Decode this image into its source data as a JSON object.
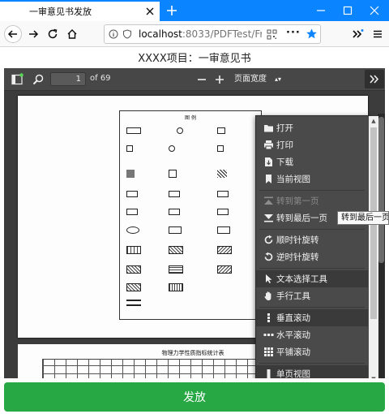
{
  "browser": {
    "tab_title": "一审意见书发放",
    "url_host": "localhost",
    "url_rest": ":8033/PDFTest/Fr"
  },
  "page": {
    "title": "XXXX项目：一审意见书"
  },
  "pdf_toolbar": {
    "page_number": "1",
    "page_count": "of 69",
    "zoom": "页面宽度"
  },
  "document": {
    "legend_title": "图 例",
    "page2_title": "物理力学性质指标统计表"
  },
  "tools_menu": {
    "items": [
      {
        "label": "打开",
        "icon": "open-icon"
      },
      {
        "label": "打印",
        "icon": "print-icon"
      },
      {
        "label": "下载",
        "icon": "download-icon"
      },
      {
        "label": "当前视图",
        "icon": "bookmark-icon"
      },
      {
        "label": "转到第一页",
        "icon": "first-page-icon",
        "disabled": true
      },
      {
        "label": "转到最后一页",
        "icon": "last-page-icon"
      },
      {
        "label": "顺时针旋转",
        "icon": "rotate-cw-icon"
      },
      {
        "label": "逆时针旋转",
        "icon": "rotate-ccw-icon"
      },
      {
        "label": "文本选择工具",
        "icon": "cursor-icon"
      },
      {
        "label": "手行工具",
        "icon": "hand-icon"
      },
      {
        "label": "垂直滚动",
        "icon": "vertical-scroll-icon"
      },
      {
        "label": "水平滚动",
        "icon": "horizontal-scroll-icon"
      },
      {
        "label": "平铺滚动",
        "icon": "wrapped-scroll-icon"
      },
      {
        "label": "单页视图",
        "icon": "single-page-icon"
      }
    ]
  },
  "tooltip": "转到最后一页",
  "actions": {
    "issue_label": "发放"
  },
  "colors": {
    "browser_accent": "#0a84ff",
    "issue_button": "#28a745"
  }
}
